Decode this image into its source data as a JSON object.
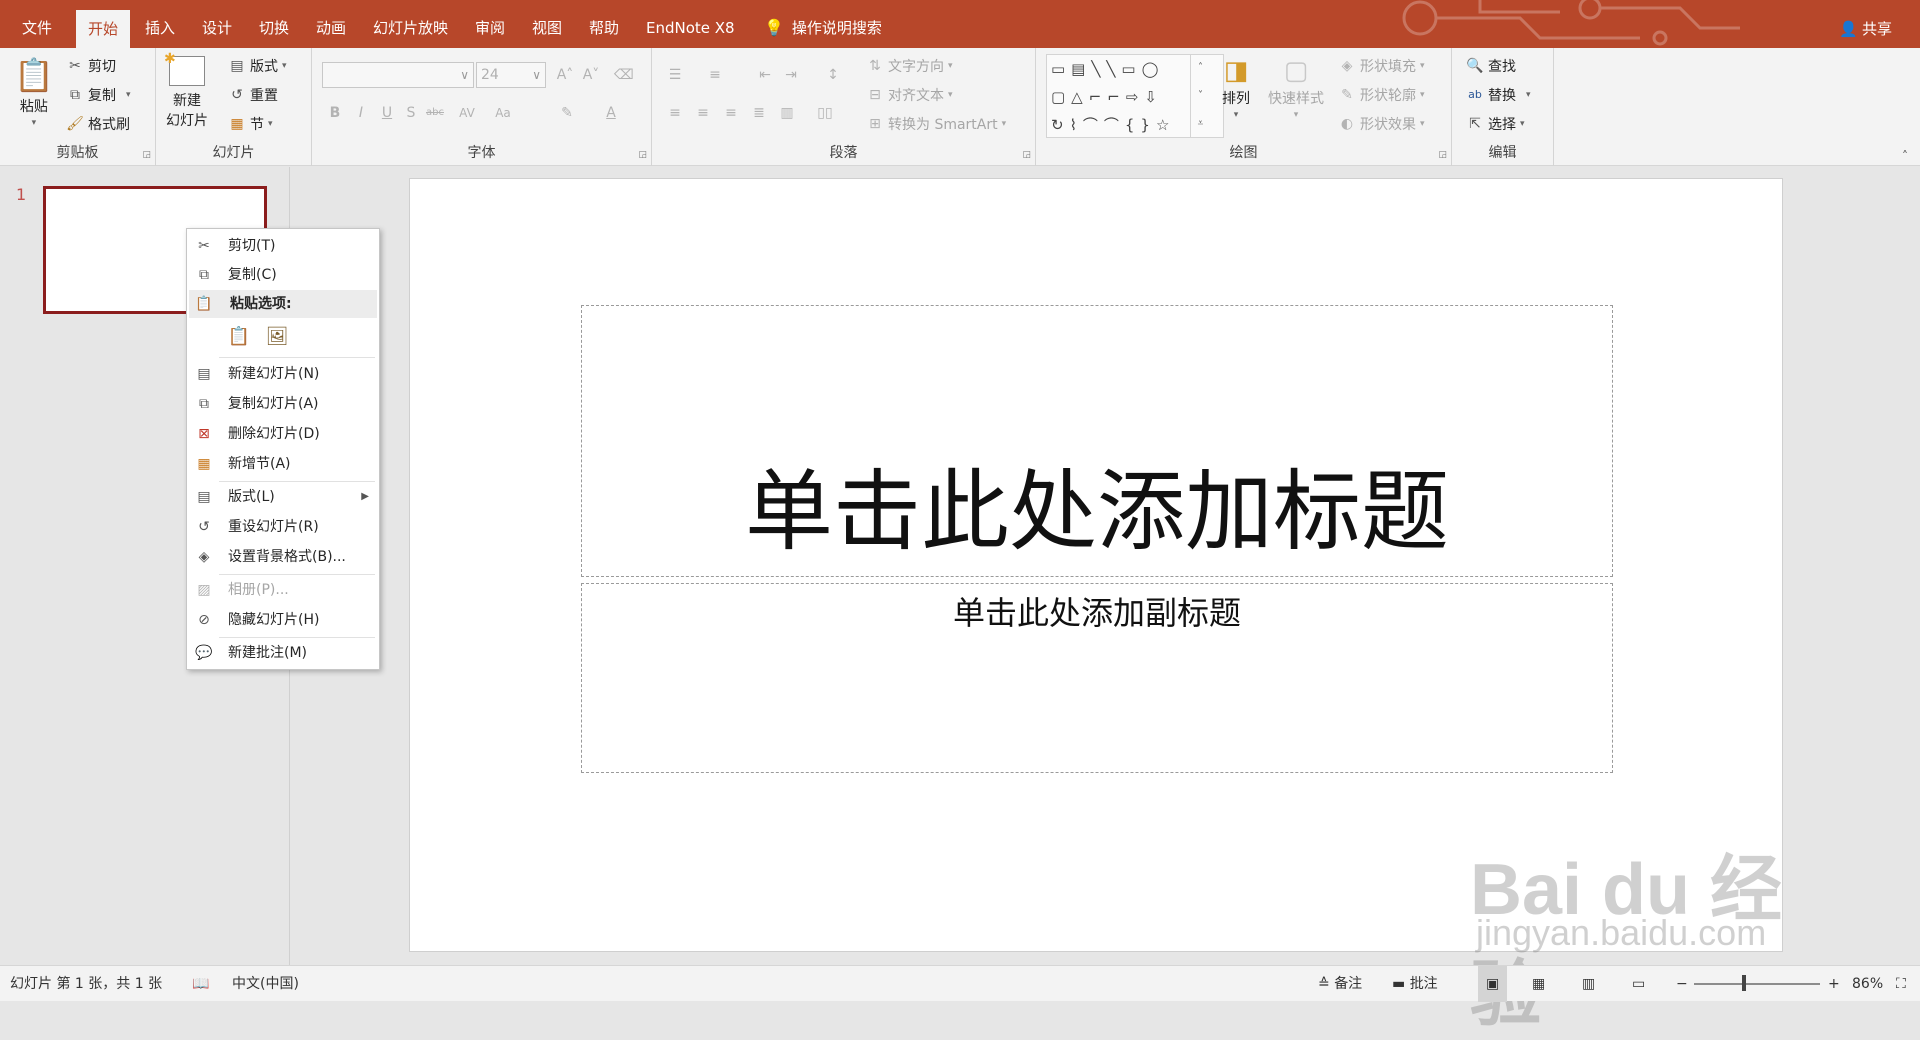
{
  "tabs": [
    {
      "label": "文件"
    },
    {
      "label": "开始"
    },
    {
      "label": "插入"
    },
    {
      "label": "设计"
    },
    {
      "label": "切换"
    },
    {
      "label": "动画"
    },
    {
      "label": "幻灯片放映"
    },
    {
      "label": "审阅"
    },
    {
      "label": "视图"
    },
    {
      "label": "帮助"
    },
    {
      "label": "EndNote X8"
    }
  ],
  "tell_me": "操作说明搜索",
  "share": "共享",
  "ribbon": {
    "clipboard": {
      "label": "剪贴板",
      "paste": "粘贴",
      "cut": "剪切",
      "copy": "复制",
      "format_painter": "格式刷"
    },
    "slides": {
      "label": "幻灯片",
      "new_slide_line1": "新建",
      "new_slide_line2": "幻灯片",
      "layout": "版式",
      "reset": "重置",
      "section": "节"
    },
    "font": {
      "label": "字体",
      "size": "24"
    },
    "paragraph": {
      "label": "段落",
      "text_direction": "文字方向",
      "align_text": "对齐文本",
      "smartart": "转换为 SmartArt"
    },
    "drawing": {
      "label": "绘图",
      "arrange": "排列",
      "quick_styles": "快速样式",
      "shape_fill": "形状填充",
      "shape_outline": "形状轮廓",
      "shape_effects": "形状效果"
    },
    "editing": {
      "label": "编辑",
      "find": "查找",
      "replace": "替换",
      "select": "选择"
    }
  },
  "thumbnail": {
    "number": "1"
  },
  "slide": {
    "title_placeholder": "单击此处添加标题",
    "subtitle_placeholder": "单击此处添加副标题"
  },
  "context_menu": {
    "cut": "剪切(T)",
    "copy": "复制(C)",
    "paste_options": "粘贴选项:",
    "new_slide": "新建幻灯片(N)",
    "duplicate_slide": "复制幻灯片(A)",
    "delete_slide": "删除幻灯片(D)",
    "add_section": "新增节(A)",
    "layout": "版式(L)",
    "reset_slide": "重设幻灯片(R)",
    "format_background": "设置背景格式(B)...",
    "photo_album": "相册(P)...",
    "hide_slide": "隐藏幻灯片(H)",
    "new_comment": "新建批注(M)"
  },
  "status": {
    "slide_info": "幻灯片 第 1 张，共 1 张",
    "language": "中文(中国)",
    "notes": "备注",
    "comments": "批注",
    "zoom": "86%"
  },
  "watermark": {
    "brand": "Bai du 经验",
    "url": "jingyan.baidu.com"
  },
  "colors": {
    "accent": "#b7472a",
    "thumb_border": "#8b1d1d"
  }
}
